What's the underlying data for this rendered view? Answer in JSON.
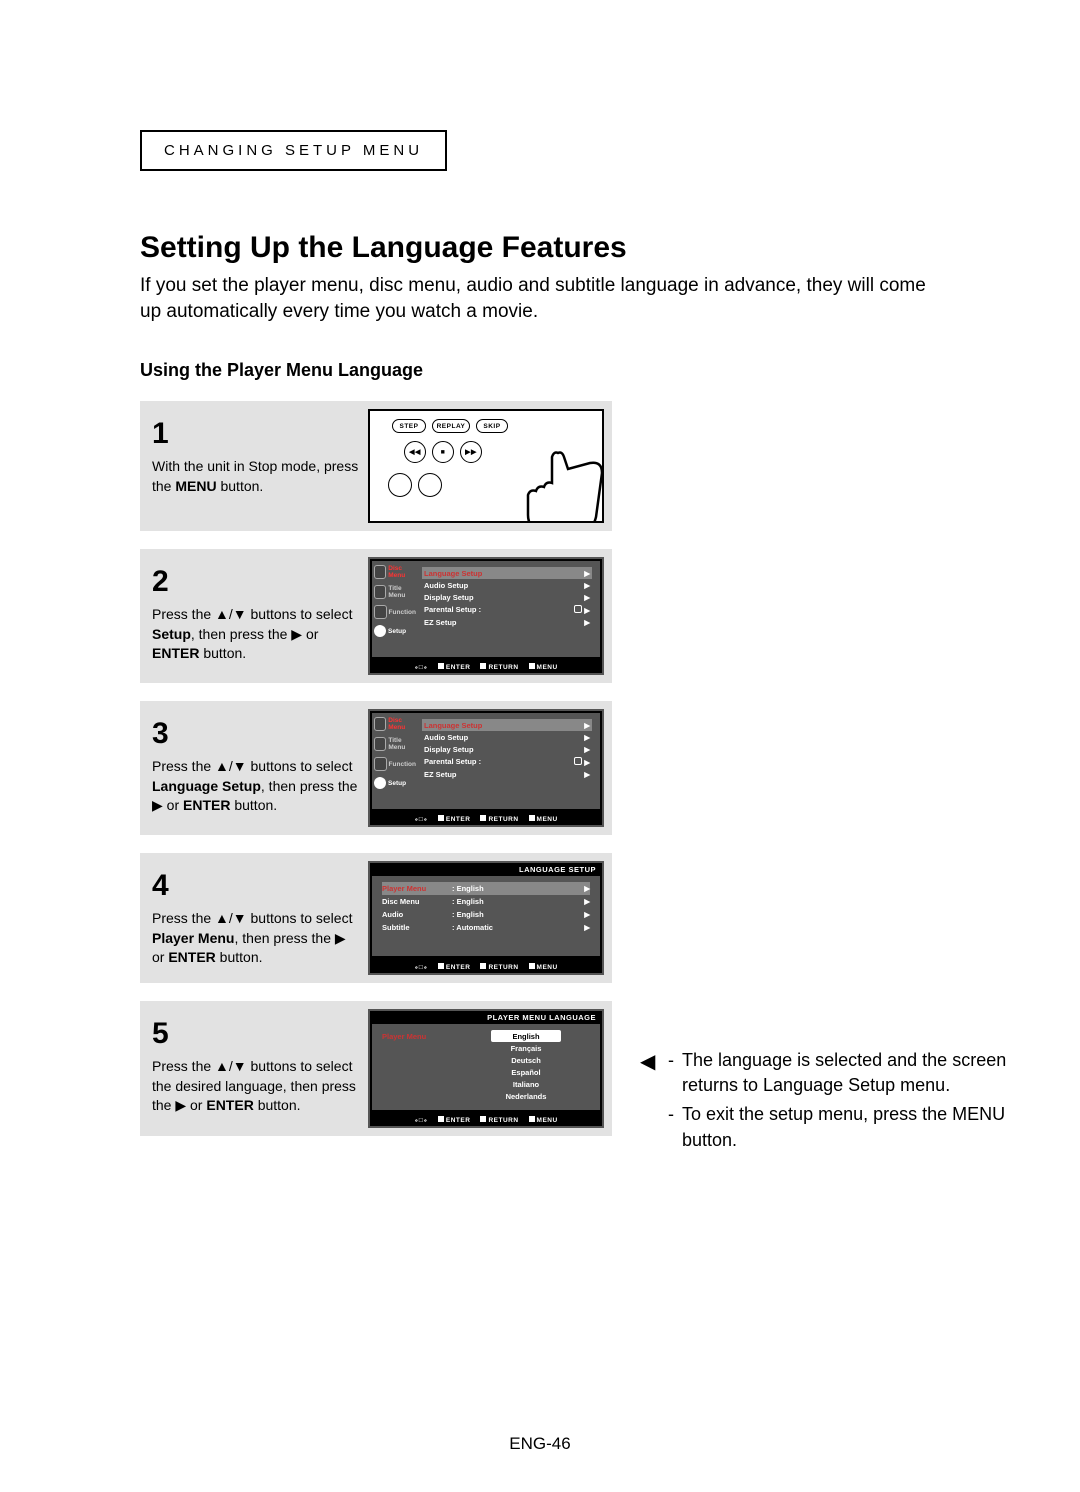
{
  "header": {
    "label": "CHANGING SETUP MENU"
  },
  "title": "Setting Up the Language Features",
  "intro": "If you set the player menu, disc menu, audio and subtitle language in advance, they will come up automatically every time you watch a movie.",
  "subhead": "Using the Player Menu Language",
  "steps": {
    "s1": {
      "num": "1",
      "text_a": "With the unit in Stop mode, press the ",
      "text_b": "MENU",
      "text_c": " button.",
      "remote_labels": {
        "step": "STEP",
        "replay": "REPLAY",
        "skip": "SKIP"
      }
    },
    "s2": {
      "num": "2",
      "text_a": "Press the ▲/▼ buttons to select ",
      "text_b": "Setup",
      "text_c": ", then press the ▶ or ",
      "text_d": "ENTER",
      "text_e": " button."
    },
    "s3": {
      "num": "3",
      "text_a": "Press the ▲/▼ buttons to select ",
      "text_b": "Language Setup",
      "text_c": ", then press the ▶ or ",
      "text_d": "ENTER",
      "text_e": " button."
    },
    "s4": {
      "num": "4",
      "text_a": "Press the ▲/▼ buttons to select ",
      "text_b": "Player Menu",
      "text_c": ", then press the ▶ or ",
      "text_d": "ENTER",
      "text_e": " button."
    },
    "s5": {
      "num": "5",
      "text_a": "Press the ▲/▼ buttons to select the desired language, then press the ▶ or ",
      "text_b": "ENTER",
      "text_c": " button."
    }
  },
  "osd_side": {
    "disc": "Disc Menu",
    "title": "Title Menu",
    "function": "Function",
    "setup": "Setup"
  },
  "osd_menu": {
    "items": [
      {
        "name": "Language Setup"
      },
      {
        "name": "Audio Setup"
      },
      {
        "name": "Display Setup"
      },
      {
        "name": "Parental Setup :",
        "lock": true
      },
      {
        "name": "EZ Setup"
      }
    ],
    "footer": {
      "enter": "ENTER",
      "return": "RETURN",
      "menu": "MENU"
    }
  },
  "lang_setup": {
    "title": "LANGUAGE SETUP",
    "rows": [
      {
        "label": "Player Menu",
        "val": ": English"
      },
      {
        "label": "Disc Menu",
        "val": ": English"
      },
      {
        "label": "Audio",
        "val": ": English"
      },
      {
        "label": "Subtitle",
        "val": ": Automatic"
      }
    ]
  },
  "pml": {
    "title": "PLAYER MENU LANGUAGE",
    "left": "Player Menu",
    "opts": [
      "English",
      "Français",
      "Deutsch",
      "Español",
      "Italiano",
      "Nederlands"
    ]
  },
  "notes": {
    "lead": "◀",
    "n1": "The language is selected and the screen returns to Language Setup menu.",
    "n2": "To exit the setup menu, press the MENU button."
  },
  "page": "ENG-46"
}
